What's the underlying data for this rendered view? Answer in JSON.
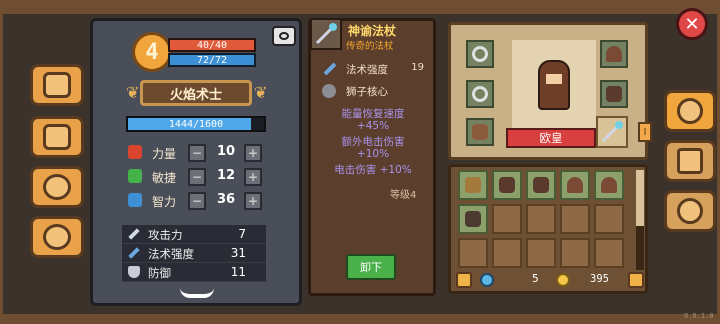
{
  "character": {
    "level": "4",
    "hp": "40/40",
    "mp": "72/72",
    "class_title": "火焰术士",
    "xp": "1444/1600",
    "xp_fraction": 0.9025,
    "attributes": [
      {
        "label": "力量",
        "value": "10",
        "icon_color": "#d9442c"
      },
      {
        "label": "敏捷",
        "value": "12",
        "icon_color": "#45b34a"
      },
      {
        "label": "智力",
        "value": "36",
        "icon_color": "#3d8fd6"
      }
    ],
    "combat": [
      {
        "label": "攻击力",
        "value": "7",
        "icon": "sword-icon"
      },
      {
        "label": "法术强度",
        "value": "31",
        "icon": "staff-icon"
      },
      {
        "label": "防御",
        "value": "11",
        "icon": "shield-icon"
      }
    ]
  },
  "item": {
    "name": "神谕法杖",
    "rarity": "传奇的法杖",
    "stats": [
      {
        "label": "法术强度",
        "value": "19",
        "icon": "staff-icon"
      },
      {
        "label": "狮子核心",
        "value": "",
        "icon": "lion-core-icon"
      }
    ],
    "bonuses": [
      "能量恢复速度",
      "+45%",
      "额外电击伤害",
      "+10%",
      "电击伤害 +10%"
    ],
    "level": "等级4",
    "unequip_label": "卸下"
  },
  "hero_name": "欧皇",
  "currency": {
    "gems": "5",
    "coins": "395"
  },
  "colors": {
    "accent_orange": "#f0a63c",
    "hp": "#e0593a",
    "mp": "#3d8fd6",
    "legendary": "#f6a72e",
    "bonus": "#a993ea",
    "unequip": "#49b04a",
    "close": "#e04848"
  },
  "version": "0.0.1.0"
}
